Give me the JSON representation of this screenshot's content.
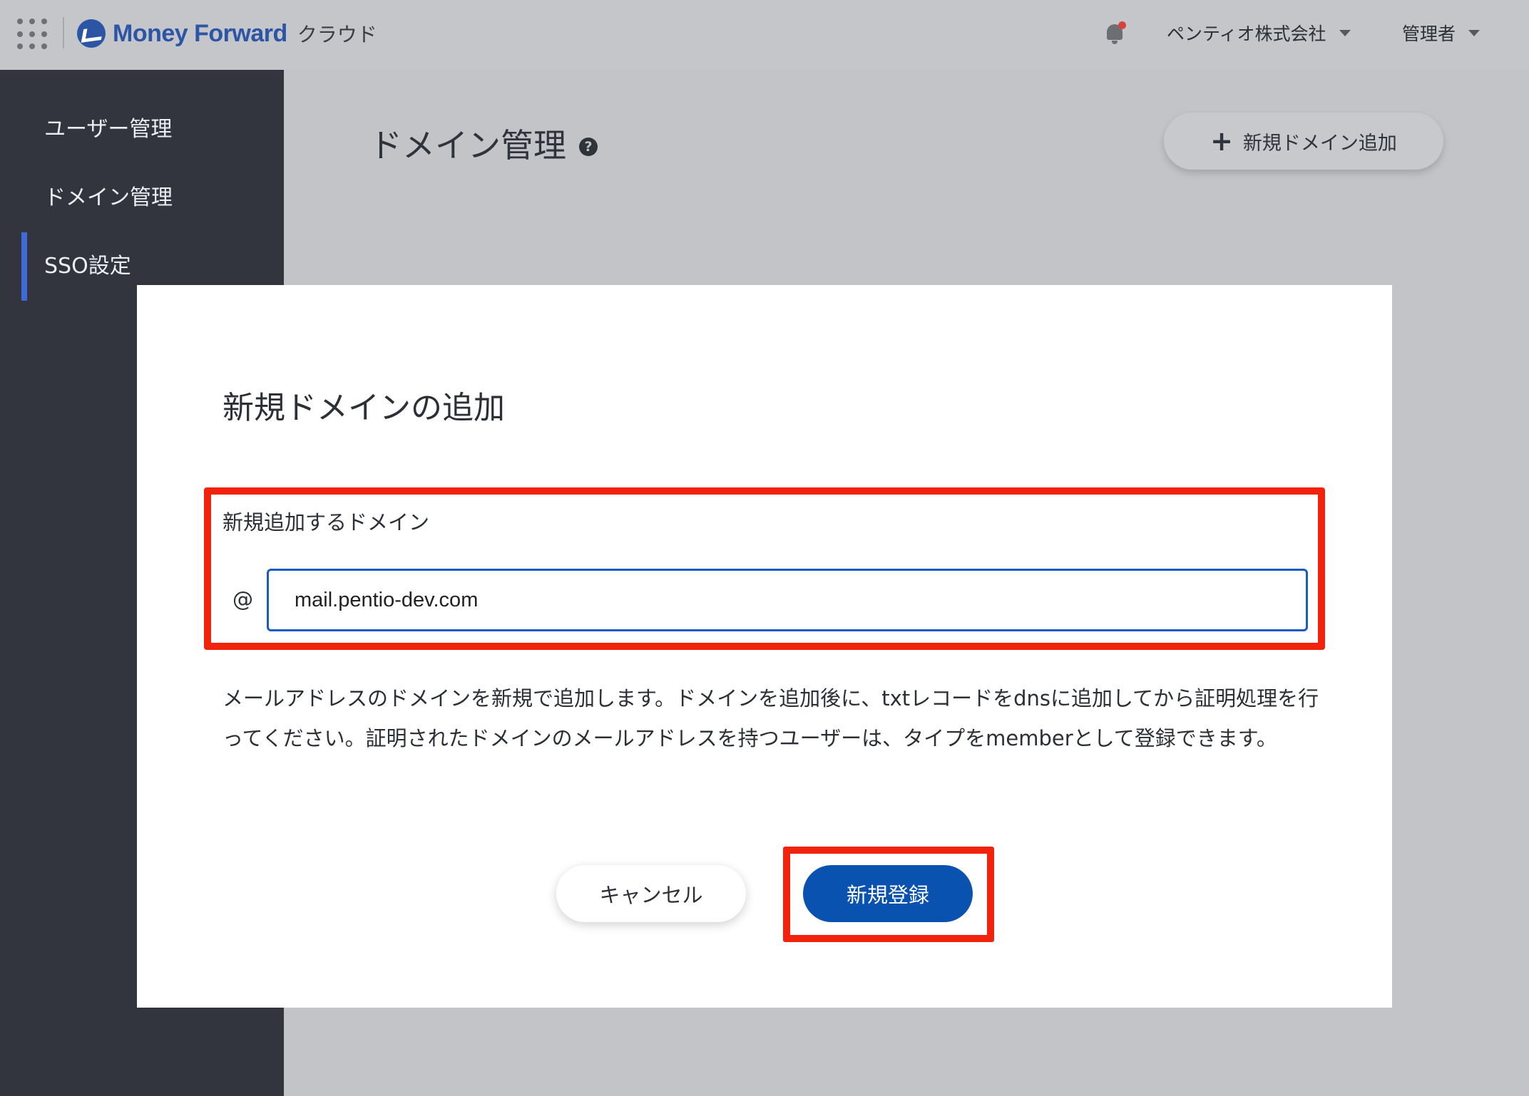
{
  "header": {
    "logo_text": "Money Forward",
    "logo_sub": "クラウド",
    "company": "ペンティオ株式会社",
    "role": "管理者"
  },
  "sidebar": {
    "items": [
      {
        "label": "ユーザー管理"
      },
      {
        "label": "ドメイン管理"
      },
      {
        "label": "SSO設定"
      }
    ]
  },
  "main": {
    "title": "ドメイン管理",
    "add_button_label": "新規ドメイン追加"
  },
  "modal": {
    "title": "新規ドメインの追加",
    "field_label": "新規追加するドメイン",
    "at_sign": "@",
    "domain_value": "mail.pentio-dev.com",
    "description": "メールアドレスのドメインを新規で追加します。ドメインを追加後に、txtレコードをdnsに追加してから証明処理を行ってください。証明されたドメインのメールアドレスを持つユーザーは、タイプをmemberとして登録できます。",
    "cancel_label": "キャンセル",
    "submit_label": "新規登録"
  },
  "colors": {
    "primary": "#0a52b0",
    "highlight": "#f2230d",
    "sidebar_bg": "#32353d",
    "active_indicator": "#3f6ad8"
  }
}
